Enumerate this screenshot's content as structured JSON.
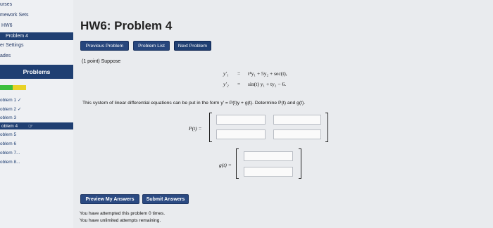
{
  "sidebar": {
    "links": [
      "urses",
      "mework Sets",
      "HW6"
    ],
    "active_link": "Problem 4",
    "settings": "er Settings",
    "grades": "ades",
    "problems_header": "Problems",
    "progress_colors": [
      "#3dbf3d",
      "#3dbf3d",
      "#e8d226",
      "#e8d226"
    ],
    "problems": [
      "oblem 1 ✓",
      "oblem 2 ✓",
      "oblem 3",
      "oblem 4",
      "oblem 5",
      "oblem 6",
      "oblem 7...",
      "oblem 8..."
    ],
    "active_problem_index": 3
  },
  "main": {
    "title": "HW6: Problem 4",
    "buttons": {
      "previous": "Previous Problem",
      "list": "Problem List",
      "next": "Next Problem"
    },
    "points": "(1 point) Suppose",
    "equations": [
      {
        "lhs": "y′₁",
        "eq": "=",
        "rhs": "t⁴y₁ + 5y₂ + sec(t),"
      },
      {
        "lhs": "y′₂",
        "eq": "=",
        "rhs": "sin(t) y₁ + ty₂ − 6."
      }
    ],
    "system_text": "This system of linear differential equations can be put in the form y′ = P(t)y + g(t). Determine P(t) and g(t).",
    "P_label": "P(t) =",
    "g_label": "g(t) =",
    "preview_button": "Preview My Answers",
    "submit_button": "Submit Answers",
    "attempts_line": "You have attempted this problem 0 times.",
    "remaining_line": "You have unlimited attempts remaining."
  }
}
